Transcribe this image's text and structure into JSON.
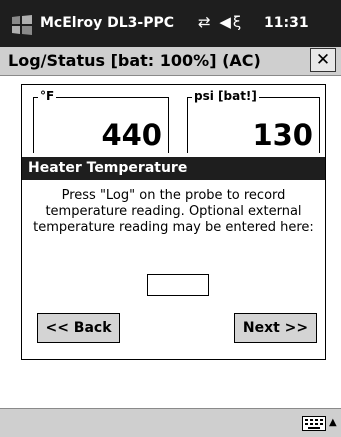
{
  "status_bar": {
    "app_name": "McElroy DL3-PPC",
    "connectivity_glyph": "⇄",
    "volume_glyph": "◀ξ",
    "time": "11:31"
  },
  "title_bar": {
    "title": "Log/Status  [bat: 100%] (AC)",
    "close_label": "✕"
  },
  "gauges": {
    "temperature": {
      "label": "°F",
      "value": "440"
    },
    "pressure": {
      "label": "psi [bat!]",
      "value": "130"
    }
  },
  "section": {
    "heading": "Heater Temperature"
  },
  "instructions": "Press \"Log\" on the probe to record temperature reading.  Optional external temperature reading may be entered here:",
  "external_temp_input": {
    "value": ""
  },
  "buttons": {
    "back": "<< Back",
    "next": "Next >>"
  },
  "command_bar": {
    "keyboard_icon": "keyboard-icon",
    "arrow_glyph": "▲"
  },
  "colors": {
    "status_bar_bg": "#1e1e1e",
    "title_bar_bg": "#cfcfcf",
    "section_bg": "#1e1e1e",
    "button_bg": "#d4d4d4"
  }
}
